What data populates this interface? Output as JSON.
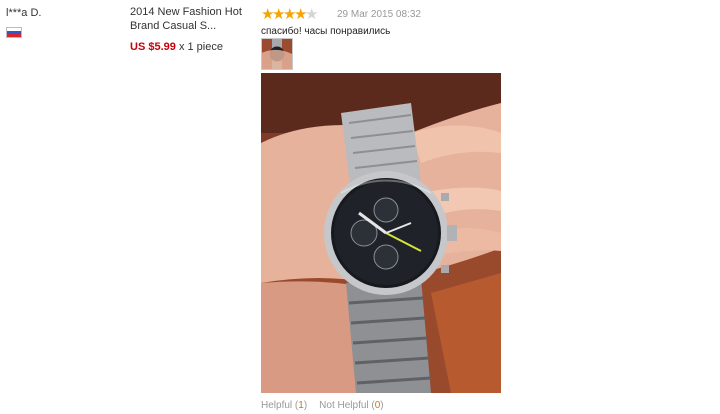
{
  "buyer": {
    "name": "l***a D.",
    "country": "Russia"
  },
  "product": {
    "title": "2014 New Fashion Hot Brand Casual S...",
    "price": "US $5.99",
    "quantity": "x 1 piece"
  },
  "review": {
    "rating": 4,
    "max_rating": 5,
    "date": "29 Mar 2015 08:32",
    "text": "спасибо! часы понравились",
    "helpful_label": "Helpful",
    "helpful_count": "1",
    "not_helpful_label": "Not Helpful",
    "not_helpful_count": "0"
  },
  "colors": {
    "star_on": "#f7a400",
    "star_off": "#d4d4d4",
    "price": "#c7000b",
    "count": "#e46d00"
  }
}
